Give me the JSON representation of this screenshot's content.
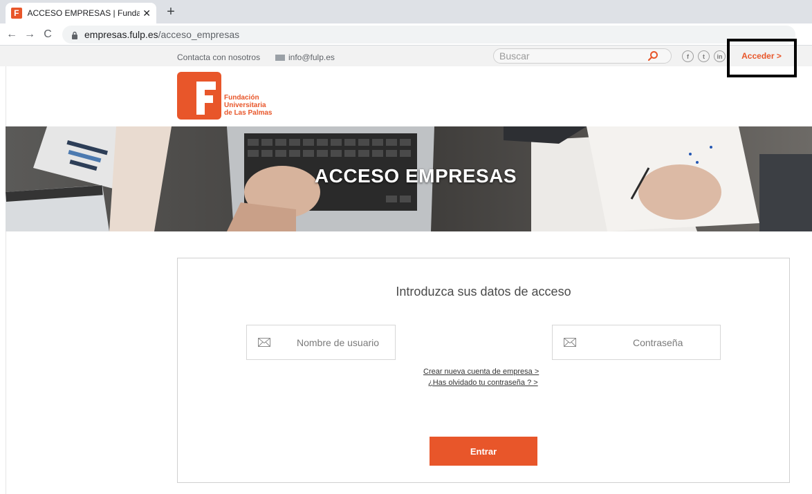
{
  "browser": {
    "tab_title": "ACCESO EMPRESAS | Fundación",
    "tab_favicon_letter": "F",
    "tab_close": "✕",
    "new_tab": "+",
    "url_domain": "empresas.fulp.es",
    "url_path": "/acceso_empresas",
    "nav": {
      "back": "←",
      "forward": "→",
      "reload": "C"
    }
  },
  "topbar": {
    "contact_label": "Contacta con nosotros",
    "email_label": "info@fulp.es",
    "search_placeholder": "Buscar",
    "social": {
      "facebook": "f",
      "twitter": "t",
      "linkedin": "in"
    },
    "acceder_label": "Acceder >"
  },
  "logo": {
    "line1": "Fundación",
    "line2": "Universitaria",
    "line3": "de Las Palmas"
  },
  "hero": {
    "title": "ACCESO EMPRESAS"
  },
  "login": {
    "title": "Introduzca sus datos de acceso",
    "username_placeholder": "Nombre de usuario",
    "password_placeholder": "Contraseña",
    "create_account_link": "Crear nueva cuenta de empresa >",
    "forgot_password_link": "¿Has olvidado tu contraseña ? >",
    "submit_label": "Entrar"
  },
  "colors": {
    "brand": "#e8562a",
    "highlight": "#000000"
  }
}
